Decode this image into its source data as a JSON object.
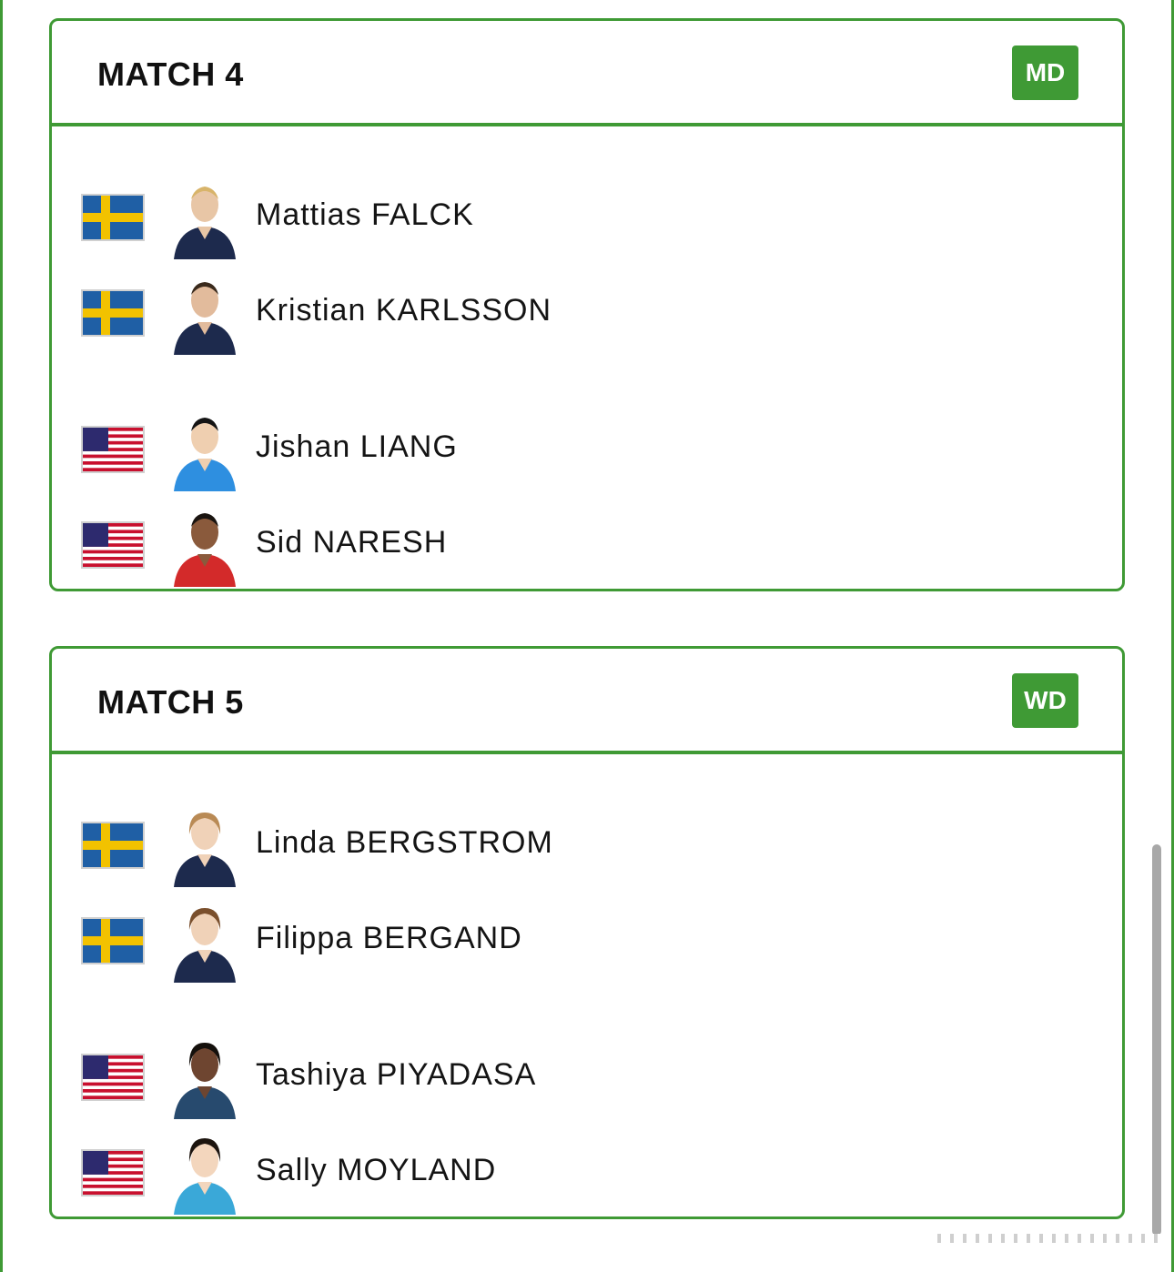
{
  "matches": [
    {
      "title": "MATCH 4",
      "badge": "MD",
      "players": [
        {
          "name": "Mattias FALCK",
          "flag": "sweden-flag",
          "avatar": "player-photo"
        },
        {
          "name": "Kristian KARLSSON",
          "flag": "sweden-flag",
          "avatar": "player-photo"
        },
        {
          "name": "Jishan LIANG",
          "flag": "usa-flag",
          "avatar": "player-photo"
        },
        {
          "name": "Sid NARESH",
          "flag": "usa-flag",
          "avatar": "player-photo"
        }
      ]
    },
    {
      "title": "MATCH 5",
      "badge": "WD",
      "players": [
        {
          "name": "Linda BERGSTROM",
          "flag": "sweden-flag",
          "avatar": "player-photo"
        },
        {
          "name": "Filippa BERGAND",
          "flag": "sweden-flag",
          "avatar": "player-photo"
        },
        {
          "name": "Tashiya PIYADASA",
          "flag": "usa-flag",
          "avatar": "player-photo"
        },
        {
          "name": "Sally MOYLAND",
          "flag": "usa-flag",
          "avatar": "player-photo"
        }
      ]
    }
  ],
  "colors": {
    "accent": "#3f9a35",
    "sweden_blue": "#1f5fa5",
    "sweden_yellow": "#f2c200",
    "usa_red": "#c8102e",
    "usa_blue": "#2d2a6e"
  }
}
